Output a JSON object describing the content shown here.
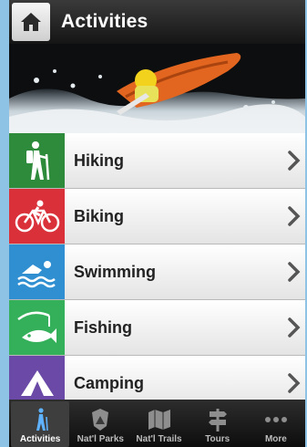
{
  "header": {
    "title": "Activities"
  },
  "activities": [
    {
      "label": "Hiking",
      "color": "#2e8b3c",
      "icon": "hiker-icon"
    },
    {
      "label": "Biking",
      "color": "#d9303a",
      "icon": "bicycle-icon"
    },
    {
      "label": "Swimming",
      "color": "#2f8fd0",
      "icon": "swimmer-icon"
    },
    {
      "label": "Fishing",
      "color": "#35b05a",
      "icon": "fish-icon"
    },
    {
      "label": "Camping",
      "color": "#6a4aa6",
      "icon": "tent-icon"
    }
  ],
  "tabs": [
    {
      "label": "Activities",
      "icon": "hiker-icon",
      "active": true
    },
    {
      "label": "Nat'l Parks",
      "icon": "park-badge-icon"
    },
    {
      "label": "Nat'l Trails",
      "icon": "map-icon"
    },
    {
      "label": "Tours",
      "icon": "signpost-icon"
    },
    {
      "label": "More",
      "icon": "more-dots-icon"
    }
  ]
}
